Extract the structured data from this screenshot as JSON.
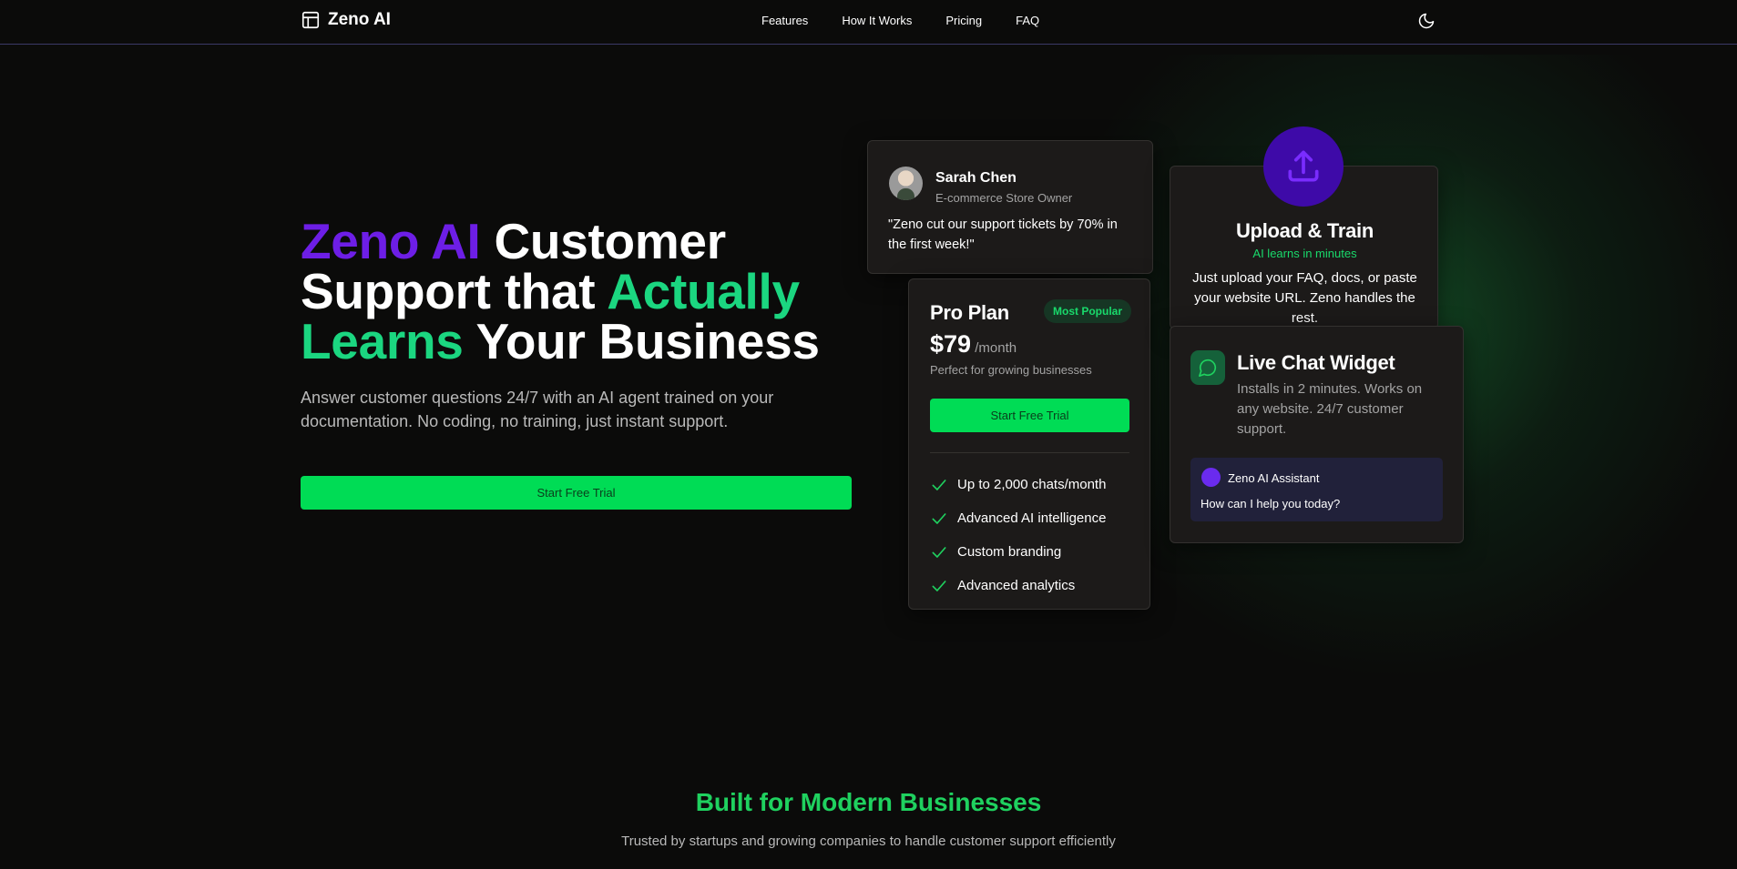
{
  "nav": {
    "brand": "Zeno AI",
    "links": [
      "Features",
      "How It Works",
      "Pricing",
      "FAQ"
    ]
  },
  "hero": {
    "title_part1": "Zeno AI",
    "title_part2": " Customer Support that ",
    "title_part3": "Actually Learns",
    "title_part4": " Your Business",
    "subtitle": "Answer customer questions 24/7 with an AI agent trained on your documentation. No coding, no training, just instant support.",
    "cta": "Start Free Trial"
  },
  "testimonial": {
    "name": "Sarah Chen",
    "role": "E-commerce Store Owner",
    "quote": "\"Zeno cut our support tickets by 70% in the first week!\""
  },
  "pricing": {
    "plan": "Pro Plan",
    "badge": "Most Popular",
    "price": "$79",
    "period": " /month",
    "description": "Perfect for growing businesses",
    "cta": "Start Free Trial",
    "features": [
      "Up to 2,000 chats/month",
      "Advanced AI intelligence",
      "Custom branding",
      "Advanced analytics"
    ]
  },
  "upload": {
    "title": "Upload & Train",
    "subtitle": "AI learns in minutes",
    "description": "Just upload your FAQ, docs, or paste your website URL. Zeno handles the rest."
  },
  "chat": {
    "title": "Live Chat Widget",
    "description": "Installs in 2 minutes. Works on any website. 24/7 customer support.",
    "assistant_name": "Zeno AI Assistant",
    "assistant_message": "How can I help you today?"
  },
  "section": {
    "title": "Built for Modern Businesses",
    "subtitle": "Trusted by startups and growing companies to handle customer support efficiently"
  },
  "colors": {
    "accent_green": "#00dc55",
    "accent_purple": "#6d1ee6",
    "text_green": "#1bd680"
  },
  "icons": {
    "logo": "layout-icon",
    "theme": "moon-icon",
    "upload": "upload-icon",
    "chat": "message-circle-icon",
    "check": "check-icon"
  }
}
